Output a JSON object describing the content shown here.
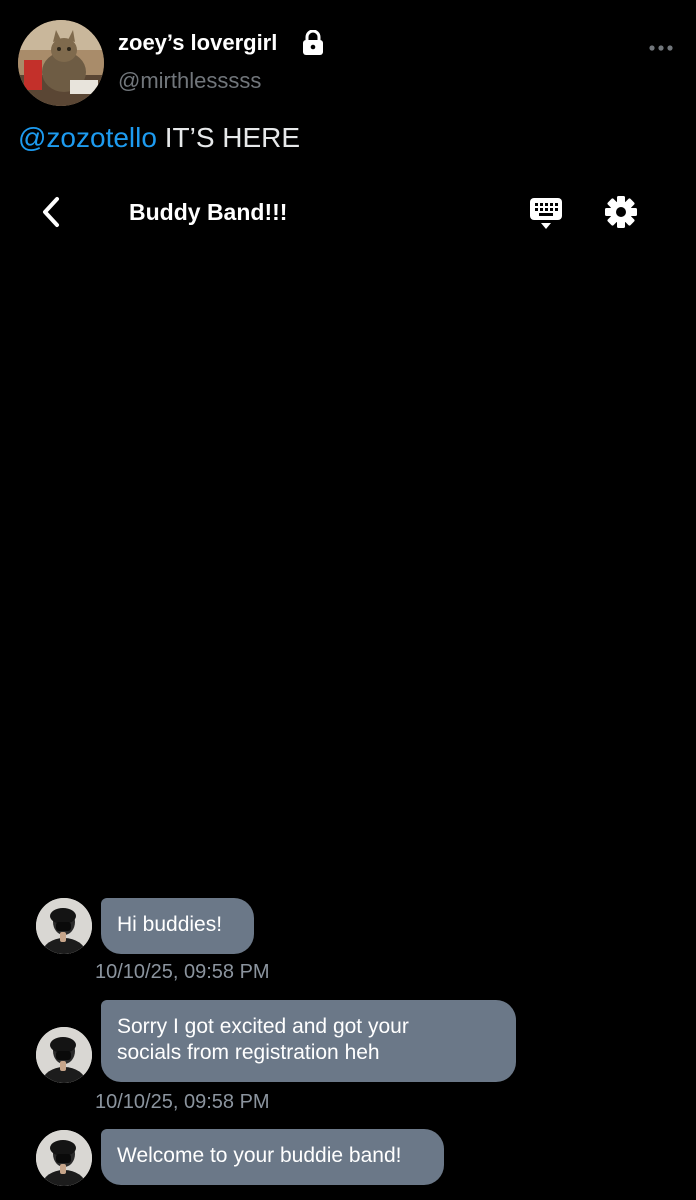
{
  "post": {
    "display_name": "zoey’s lovergirl",
    "handle": "@mirthlesssss",
    "mention": "@zozotello",
    "text": " IT’S HERE",
    "icons": {
      "lock": "lock-icon",
      "more": "more-horizontal-icon",
      "avatar": "cat-avatar"
    }
  },
  "chat": {
    "title": "Buddy Band!!!",
    "icons": {
      "back": "chevron-left-icon",
      "keyboard": "keyboard-icon",
      "settings": "gear-icon"
    },
    "messages": [
      {
        "text": "Hi buddies!",
        "timestamp": "10/10/25, 09:58 PM"
      },
      {
        "text": "Sorry I got excited and got your\nsocials from registration heh",
        "timestamp": "10/10/25, 09:58 PM"
      },
      {
        "text": "Welcome to your buddie band!",
        "timestamp": ""
      }
    ]
  },
  "colors": {
    "background": "#000000",
    "bubble": "#6b7888",
    "mention": "#1d9bf0",
    "handle": "#71767b",
    "timestamp": "#8b949e"
  }
}
